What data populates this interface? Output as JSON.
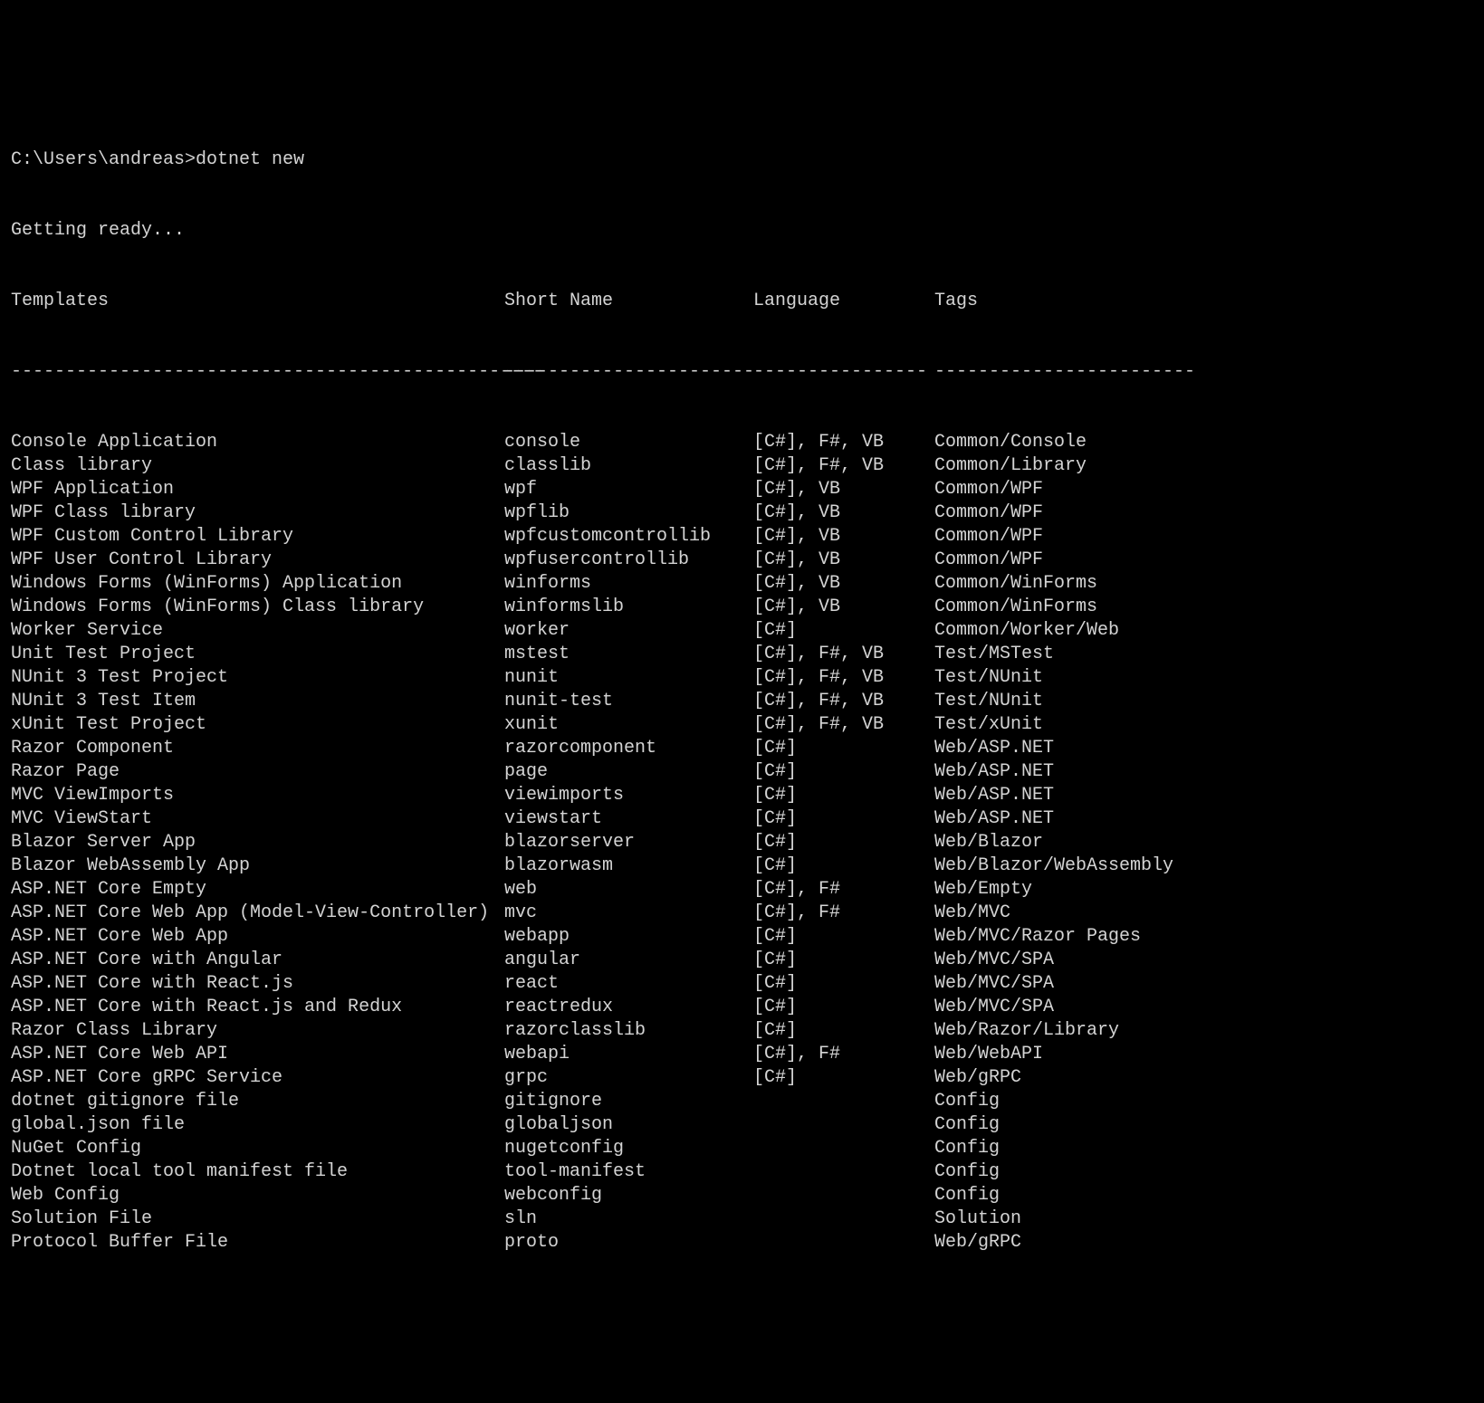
{
  "prompt": "C:\\Users\\andreas>dotnet new",
  "loading": "Getting ready...",
  "headers": {
    "templates": "Templates",
    "shortname": "Short Name",
    "language": "Language",
    "tags": "Tags"
  },
  "dividers": {
    "templates": "-------------------------------------------------",
    "shortname": "-----------------------",
    "language": "----------------",
    "tags": "------------------------"
  },
  "rows": [
    {
      "templates": "Console Application",
      "shortname": "console",
      "language": "[C#], F#, VB",
      "tags": "Common/Console"
    },
    {
      "templates": "Class library",
      "shortname": "classlib",
      "language": "[C#], F#, VB",
      "tags": "Common/Library"
    },
    {
      "templates": "WPF Application",
      "shortname": "wpf",
      "language": "[C#], VB",
      "tags": "Common/WPF"
    },
    {
      "templates": "WPF Class library",
      "shortname": "wpflib",
      "language": "[C#], VB",
      "tags": "Common/WPF"
    },
    {
      "templates": "WPF Custom Control Library",
      "shortname": "wpfcustomcontrollib",
      "language": "[C#], VB",
      "tags": "Common/WPF"
    },
    {
      "templates": "WPF User Control Library",
      "shortname": "wpfusercontrollib",
      "language": "[C#], VB",
      "tags": "Common/WPF"
    },
    {
      "templates": "Windows Forms (WinForms) Application",
      "shortname": "winforms",
      "language": "[C#], VB",
      "tags": "Common/WinForms"
    },
    {
      "templates": "Windows Forms (WinForms) Class library",
      "shortname": "winformslib",
      "language": "[C#], VB",
      "tags": "Common/WinForms"
    },
    {
      "templates": "Worker Service",
      "shortname": "worker",
      "language": "[C#]",
      "tags": "Common/Worker/Web"
    },
    {
      "templates": "Unit Test Project",
      "shortname": "mstest",
      "language": "[C#], F#, VB",
      "tags": "Test/MSTest"
    },
    {
      "templates": "NUnit 3 Test Project",
      "shortname": "nunit",
      "language": "[C#], F#, VB",
      "tags": "Test/NUnit"
    },
    {
      "templates": "NUnit 3 Test Item",
      "shortname": "nunit-test",
      "language": "[C#], F#, VB",
      "tags": "Test/NUnit"
    },
    {
      "templates": "xUnit Test Project",
      "shortname": "xunit",
      "language": "[C#], F#, VB",
      "tags": "Test/xUnit"
    },
    {
      "templates": "Razor Component",
      "shortname": "razorcomponent",
      "language": "[C#]",
      "tags": "Web/ASP.NET"
    },
    {
      "templates": "Razor Page",
      "shortname": "page",
      "language": "[C#]",
      "tags": "Web/ASP.NET"
    },
    {
      "templates": "MVC ViewImports",
      "shortname": "viewimports",
      "language": "[C#]",
      "tags": "Web/ASP.NET"
    },
    {
      "templates": "MVC ViewStart",
      "shortname": "viewstart",
      "language": "[C#]",
      "tags": "Web/ASP.NET"
    },
    {
      "templates": "Blazor Server App",
      "shortname": "blazorserver",
      "language": "[C#]",
      "tags": "Web/Blazor"
    },
    {
      "templates": "Blazor WebAssembly App",
      "shortname": "blazorwasm",
      "language": "[C#]",
      "tags": "Web/Blazor/WebAssembly"
    },
    {
      "templates": "ASP.NET Core Empty",
      "shortname": "web",
      "language": "[C#], F#",
      "tags": "Web/Empty"
    },
    {
      "templates": "ASP.NET Core Web App (Model-View-Controller)",
      "shortname": "mvc",
      "language": "[C#], F#",
      "tags": "Web/MVC"
    },
    {
      "templates": "ASP.NET Core Web App",
      "shortname": "webapp",
      "language": "[C#]",
      "tags": "Web/MVC/Razor Pages"
    },
    {
      "templates": "ASP.NET Core with Angular",
      "shortname": "angular",
      "language": "[C#]",
      "tags": "Web/MVC/SPA"
    },
    {
      "templates": "ASP.NET Core with React.js",
      "shortname": "react",
      "language": "[C#]",
      "tags": "Web/MVC/SPA"
    },
    {
      "templates": "ASP.NET Core with React.js and Redux",
      "shortname": "reactredux",
      "language": "[C#]",
      "tags": "Web/MVC/SPA"
    },
    {
      "templates": "Razor Class Library",
      "shortname": "razorclasslib",
      "language": "[C#]",
      "tags": "Web/Razor/Library"
    },
    {
      "templates": "ASP.NET Core Web API",
      "shortname": "webapi",
      "language": "[C#], F#",
      "tags": "Web/WebAPI"
    },
    {
      "templates": "ASP.NET Core gRPC Service",
      "shortname": "grpc",
      "language": "[C#]",
      "tags": "Web/gRPC"
    },
    {
      "templates": "dotnet gitignore file",
      "shortname": "gitignore",
      "language": "",
      "tags": "Config"
    },
    {
      "templates": "global.json file",
      "shortname": "globaljson",
      "language": "",
      "tags": "Config"
    },
    {
      "templates": "NuGet Config",
      "shortname": "nugetconfig",
      "language": "",
      "tags": "Config"
    },
    {
      "templates": "Dotnet local tool manifest file",
      "shortname": "tool-manifest",
      "language": "",
      "tags": "Config"
    },
    {
      "templates": "Web Config",
      "shortname": "webconfig",
      "language": "",
      "tags": "Config"
    },
    {
      "templates": "Solution File",
      "shortname": "sln",
      "language": "",
      "tags": "Solution"
    },
    {
      "templates": "Protocol Buffer File",
      "shortname": "proto",
      "language": "",
      "tags": "Web/gRPC"
    }
  ]
}
